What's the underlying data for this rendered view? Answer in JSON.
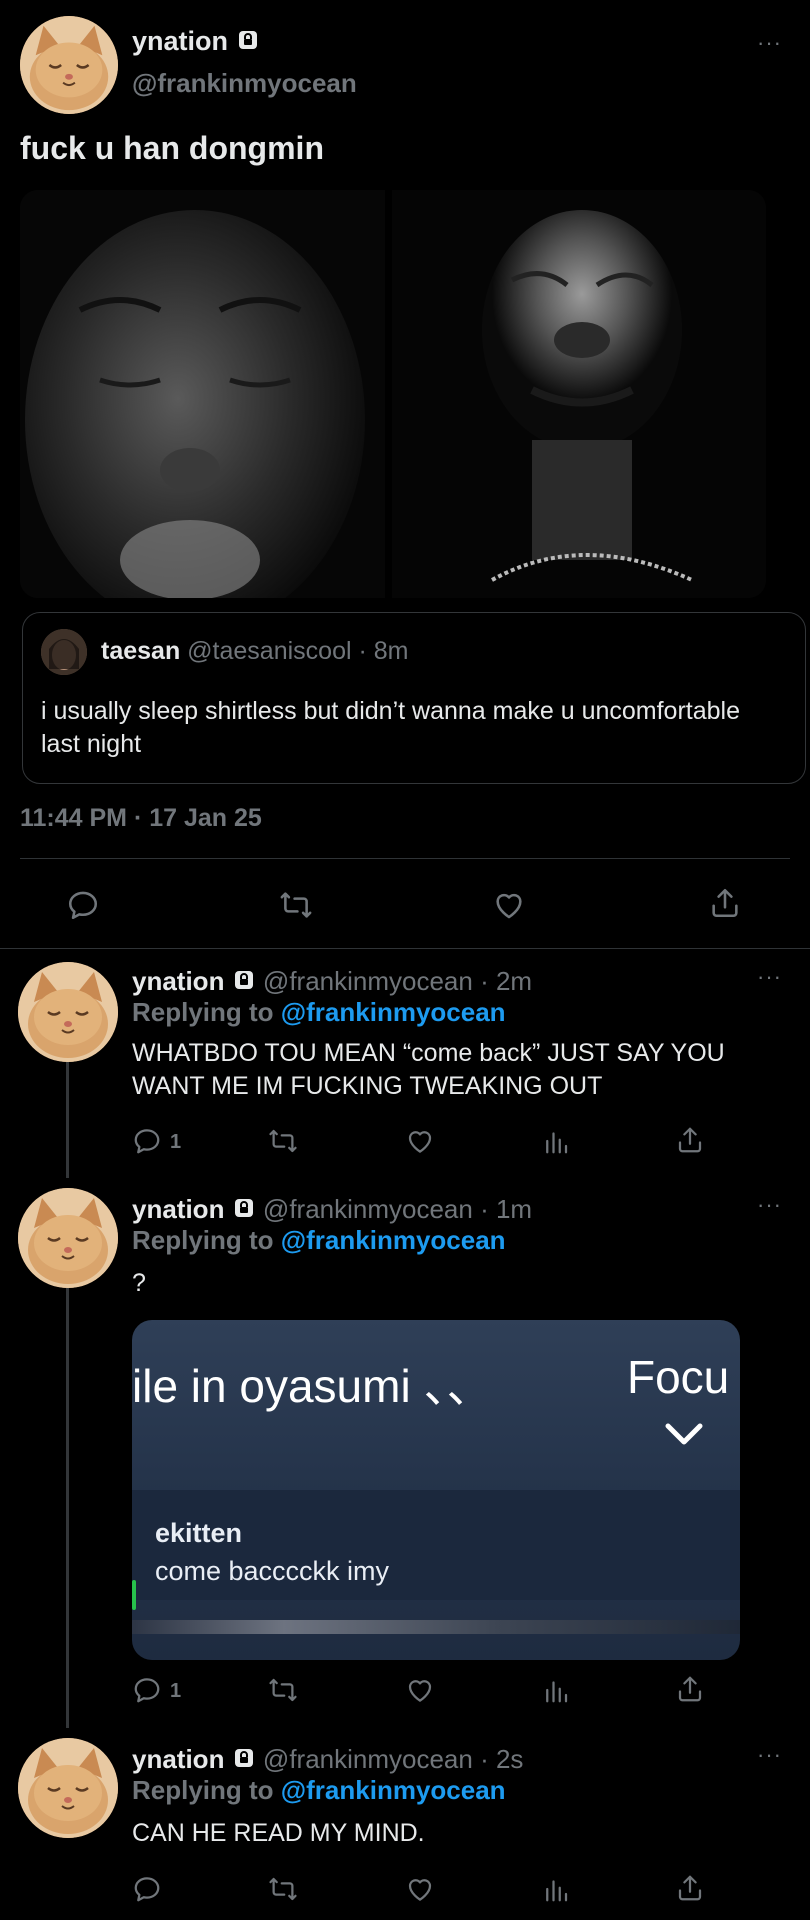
{
  "main_tweet": {
    "display_name": "ynation",
    "handle": "@frankinmyocean",
    "text": "fuck u han dongmin",
    "timestamp": "11:44 PM · 17 Jan 25",
    "more": "···",
    "quoted": {
      "display_name": "taesan",
      "handle": "@taesaniscool",
      "time": "· 8m",
      "text": "i usually sleep shirtless but didn’t wanna make u uncomfortable last night"
    },
    "actions": [
      "reply-icon",
      "retweet-icon",
      "like-icon",
      "share-icon"
    ]
  },
  "replies": [
    {
      "display_name": "ynation",
      "handle": "@frankinmyocean",
      "time": "· 2m",
      "replying_prefix": "Replying to",
      "replying_to": "@frankinmyocean",
      "text": "WHATBDO TOU MEAN “come back” JUST SAY YOU WANT ME IM FUCKING TWEAKING OUT",
      "reply_count": "1",
      "more": "···"
    },
    {
      "display_name": "ynation",
      "handle": "@frankinmyocean",
      "time": "· 1m",
      "replying_prefix": "Replying to",
      "replying_to": "@frankinmyocean",
      "text": "?",
      "reply_count": "1",
      "more": "···",
      "embed": {
        "header_title": "ile in oyasumi 、、",
        "header_right": "Focu",
        "username": "ekitten",
        "message": "come bacccckk imy"
      }
    },
    {
      "display_name": "ynation",
      "handle": "@frankinmyocean",
      "time": "· 2s",
      "replying_prefix": "Replying to",
      "replying_to": "@frankinmyocean",
      "text": "CAN HE READ MY MIND.",
      "reply_count": "",
      "more": "···"
    }
  ],
  "colors": {
    "background": "#000000",
    "text": "#e7e9ea",
    "muted": "#71767b",
    "link": "#1d9bf0",
    "divider": "#2f3336"
  }
}
